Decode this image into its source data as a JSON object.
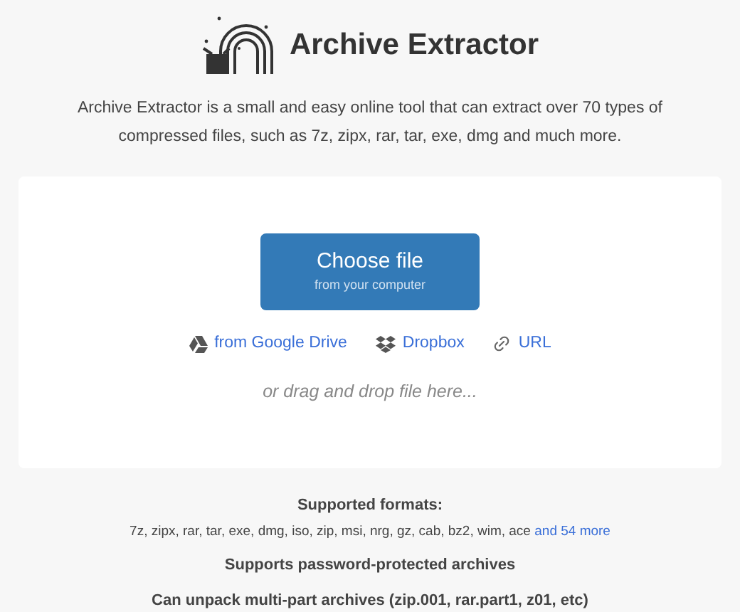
{
  "header": {
    "title": "Archive Extractor"
  },
  "intro": "Archive Extractor is a small and easy online tool that can extract over 70 types of compressed files, such as 7z, zipx, rar, tar, exe, dmg and much more.",
  "upload": {
    "button_title": "Choose file",
    "button_subtitle": "from your computer",
    "sources": [
      {
        "kind": "drive",
        "label": "from Google Drive"
      },
      {
        "kind": "dropbox",
        "label": "Dropbox"
      },
      {
        "kind": "url",
        "label": "URL"
      }
    ],
    "drop_hint": "or drag and drop file here..."
  },
  "formats": {
    "heading": "Supported formats:",
    "list": "7z, zipx, rar, tar, exe, dmg, iso, zip, msi, nrg, gz, cab, bz2, wim, ace",
    "more_link": "and 54 more"
  },
  "features": [
    "Supports password-protected archives",
    "Can unpack multi-part archives (zip.001, rar.part1, z01, etc)"
  ]
}
